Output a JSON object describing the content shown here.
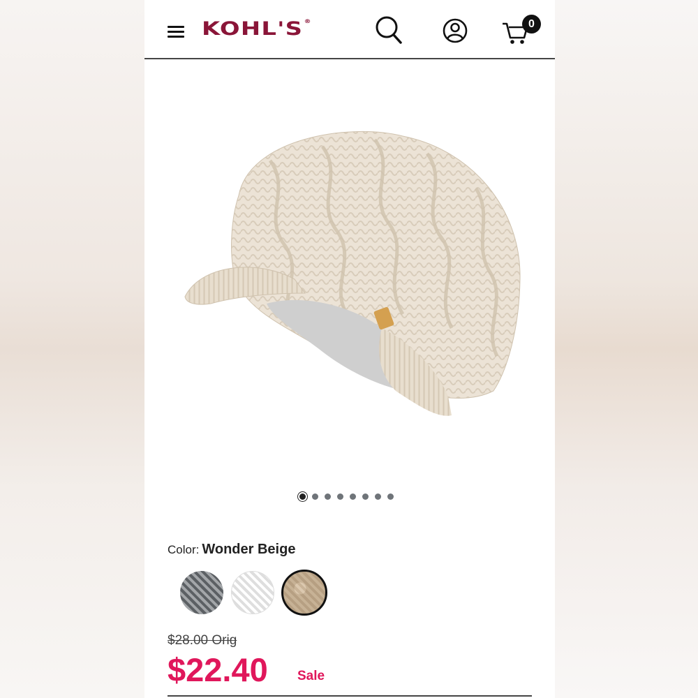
{
  "header": {
    "menu_icon": "hamburger-menu-icon",
    "logo_text": "KOHL'S",
    "logo_registered": "®",
    "search_icon": "search-icon",
    "account_icon": "account-icon",
    "cart_icon": "shopping-cart-icon",
    "cart_count": "0"
  },
  "product": {
    "image_subject": "beige cable-knit visor beanie",
    "image_dots_total": 8,
    "image_dots_active": 1,
    "color_label": "Color:",
    "color_value": "Wonder Beige",
    "swatches": [
      {
        "name": "gray",
        "color": "#7b7e82",
        "selected": false
      },
      {
        "name": "white",
        "color": "#f2f2f2",
        "selected": false
      },
      {
        "name": "beige",
        "color": "#e6dacb",
        "selected": true
      }
    ],
    "original_price": "$28.00 Orig",
    "sale_price": "$22.40",
    "sale_label": "Sale"
  },
  "colors": {
    "brand": "#8a1538",
    "sale": "#e0175b"
  }
}
